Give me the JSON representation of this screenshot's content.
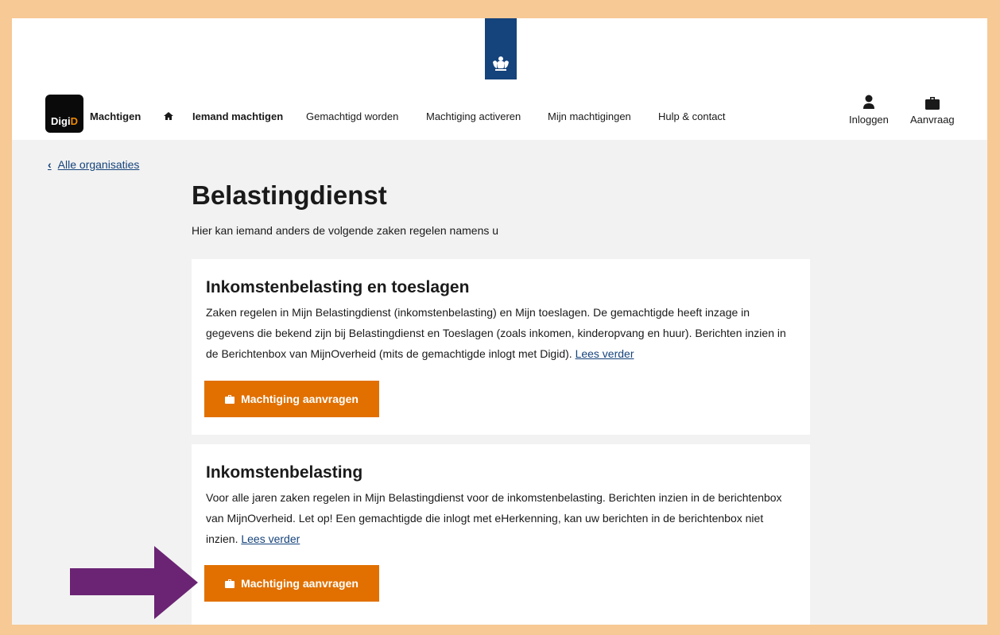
{
  "header": {
    "logo_text": "DigiD",
    "logo_text_part1": "Digi",
    "logo_text_part2": "D",
    "app_name": "Machtigen",
    "nav": [
      {
        "label": "Iemand machtigen",
        "active": true
      },
      {
        "label": "Gemachtigd worden",
        "active": false
      },
      {
        "label": "Machtiging activeren",
        "active": false
      },
      {
        "label": "Mijn machtigingen",
        "active": false
      },
      {
        "label": "Hulp & contact",
        "active": false
      }
    ],
    "login_label": "Inloggen",
    "request_label": "Aanvraag",
    "icons": [
      "home-icon",
      "user-icon",
      "briefcase-icon"
    ]
  },
  "back_link": "Alle organisaties",
  "page_title": "Belastingdienst",
  "intro": "Hier kan iemand anders de volgende zaken regelen namens u",
  "cards": [
    {
      "title": "Inkomstenbelasting en toeslagen",
      "text": "Zaken regelen in Mijn Belastingdienst (inkomstenbelasting) en Mijn toeslagen. De gemachtigde heeft inzage in gegevens die bekend zijn bij Belastingdienst en Toeslagen (zoals inkomen, kinderopvang en huur). Berichten inzien in de Berichtenbox van MijnOverheid (mits de gemachtigde inlogt met Digid).",
      "link": "Lees verder",
      "button": "Machtiging aanvragen"
    },
    {
      "title": "Inkomstenbelasting",
      "text": "Voor alle jaren zaken regelen in Mijn Belastingdienst voor de inkomstenbelasting. Berichten inzien in de berichtenbox van MijnOverheid. Let op! Een gemachtigde die inlogt met eHerkenning, kan uw berichten in de berichtenbox niet inzien.",
      "link": "Lees verder",
      "button": "Machtiging aanvragen"
    }
  ],
  "colors": {
    "outer_border": "#f7c995",
    "rijks_blue": "#15437b",
    "button_orange": "#e17000",
    "digid_orange": "#f18a00",
    "arrow_purple": "#6b2474",
    "content_bg": "#f2f2f2"
  }
}
